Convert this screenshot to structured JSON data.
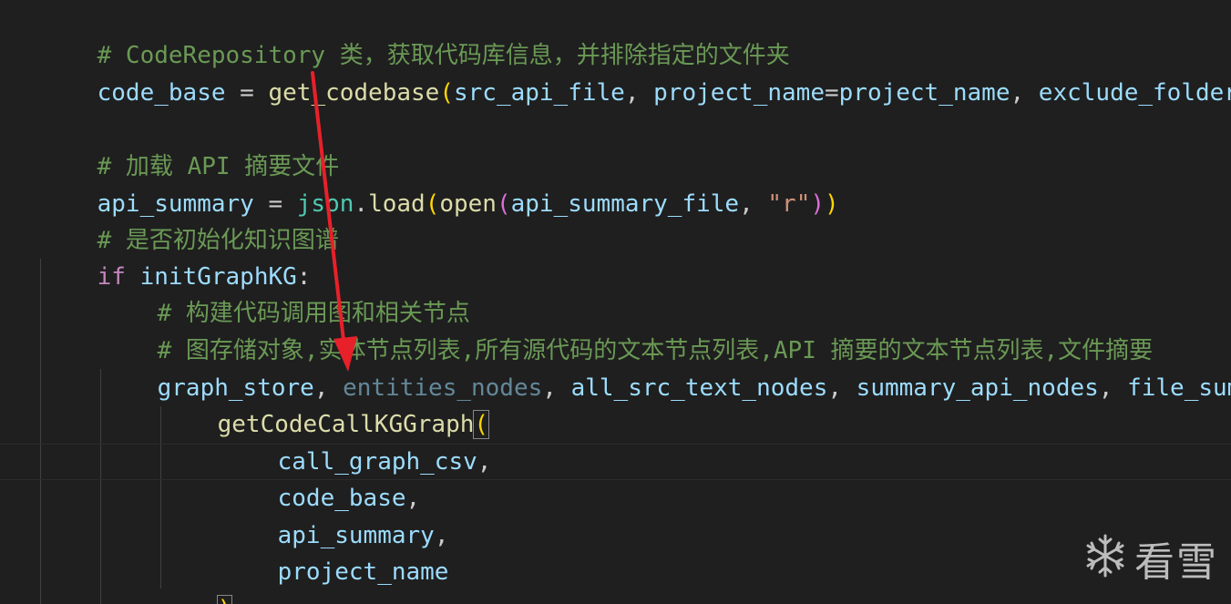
{
  "editor": {
    "lines": [
      {
        "text": "# CodeRepository 类，获取代码库信息，并排除指定的文件夹"
      },
      {
        "text": "code_base = get_codebase(src_api_file, project_name=project_name, exclude_folders"
      },
      {
        "text": ""
      },
      {
        "text": "# 加载 API 摘要文件"
      },
      {
        "text": "api_summary = json.load(open(api_summary_file, \"r\"))"
      },
      {
        "text": "# 是否初始化知识图谱"
      },
      {
        "text": "if initGraphKG:"
      },
      {
        "text": "    # 构建代码调用图和相关节点"
      },
      {
        "text": "    # 图存储对象,实体节点列表,所有源代码的文本节点列表,API 摘要的文本节点列表,文件摘要"
      },
      {
        "text": "    graph_store, entities_nodes, all_src_text_nodes, summary_api_nodes, file_sum"
      },
      {
        "text": "        getCodeCallKGGraph("
      },
      {
        "text": "            call_graph_csv,"
      },
      {
        "text": "            code_base,"
      },
      {
        "text": "            api_summary,"
      },
      {
        "text": "            project_name"
      },
      {
        "text": "        )"
      }
    ],
    "tokens": {
      "l0_comment": "# CodeRepository 类，获取代码库信息，并排除指定的文件夹",
      "l1_code_base": "code_base",
      "l1_eq": " = ",
      "l1_func": "get_codebase",
      "l1_open": "(",
      "l1_arg1": "src_api_file",
      "l1_comma1": ", ",
      "l1_param": "project_name",
      "l1_eq2": "=",
      "l1_arg2": "project_name",
      "l1_comma2": ", ",
      "l1_arg3": "exclude_folders",
      "l3_comment": "# 加载 API 摘要文件",
      "l4_var": "api_summary",
      "l4_eq": " = ",
      "l4_json": "json",
      "l4_dot": ".",
      "l4_load": "load",
      "l4_open1": "(",
      "l4_openfn": "open",
      "l4_open2": "(",
      "l4_arg": "api_summary_file",
      "l4_comma": ", ",
      "l4_str": "\"r\"",
      "l4_close2": ")",
      "l4_close1": ")",
      "l5_comment": "# 是否初始化知识图谱",
      "l6_if": "if",
      "l6_sp": " ",
      "l6_var": "initGraphKG",
      "l6_colon": ":",
      "l7_comment": "# 构建代码调用图和相关节点",
      "l8_comment": "# 图存储对象,实体节点列表,所有源代码的文本节点列表,API 摘要的文本节点列表,文件摘要",
      "l9_v1": "graph_store",
      "l9_c1": ", ",
      "l9_v2": "entities_nodes",
      "l9_c2": ", ",
      "l9_v3": "all_src_text_nodes",
      "l9_c3": ", ",
      "l9_v4": "summary_api_nodes",
      "l9_c4": ", ",
      "l9_v5": "file_sum",
      "l10_func": "getCodeCallKGGraph",
      "l10_open": "(",
      "l11_arg": "call_graph_csv",
      "l11_comma": ",",
      "l12_arg": "code_base",
      "l12_comma": ",",
      "l13_arg": "api_summary",
      "l13_comma": ",",
      "l14_arg": "project_name",
      "l15_close": ")"
    }
  },
  "watermark": {
    "text": "看雪",
    "icon": "snowflake-icon"
  },
  "colors": {
    "background": "#1f1f1f",
    "comment": "#6a9955",
    "variable": "#9cdcfe",
    "function": "#dcdcaa",
    "keyword": "#c586c0",
    "string": "#ce9178",
    "bracket1": "#ffd700",
    "bracket2": "#da70d6",
    "arrow": "#e8202a"
  }
}
